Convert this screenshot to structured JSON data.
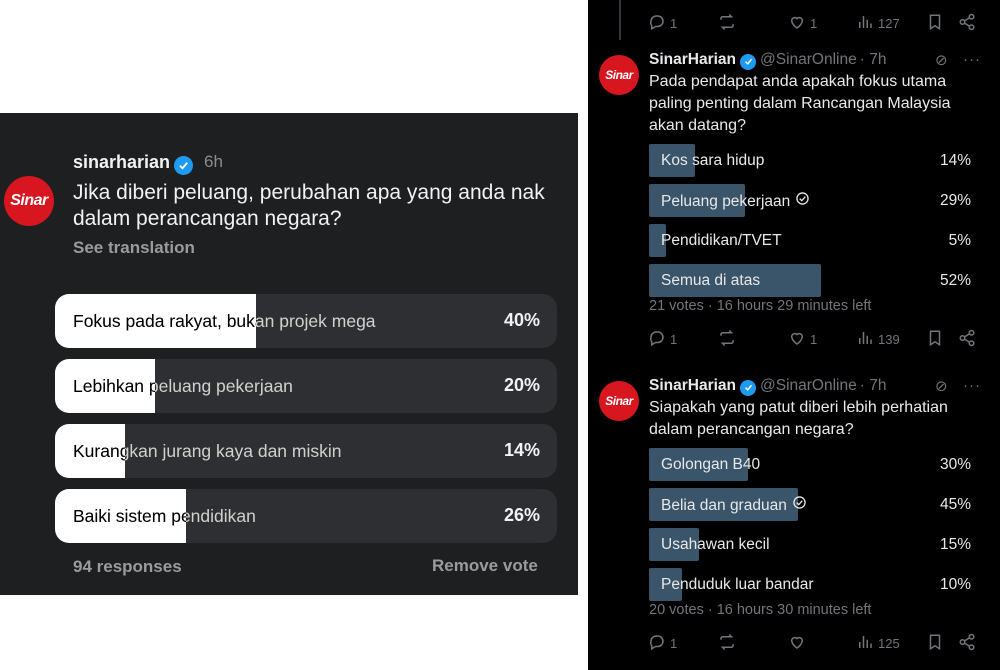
{
  "threads_post": {
    "username": "sinarharian",
    "time": "6h",
    "avatar_text": "Sinar",
    "question": "Jika diberi peluang, perubahan apa yang anda nak dalam perancangan negara?",
    "see_translation": "See translation",
    "options": [
      {
        "label": "Fokus pada rakyat, bukan projek mega",
        "percent_text": "40%",
        "percent": 40
      },
      {
        "label": "Lebihkan peluang pekerjaan",
        "percent_text": "20%",
        "percent": 20
      },
      {
        "label": "Kurangkan jurang kaya dan miskin",
        "percent_text": "14%",
        "percent": 14
      },
      {
        "label": "Baiki sistem pendidikan",
        "percent_text": "26%",
        "percent": 26
      }
    ],
    "responses": "94 responses",
    "remove_vote": "Remove vote"
  },
  "x_feed": {
    "top_actions": {
      "replies": "1",
      "reposts": "",
      "likes": "1",
      "views": "127"
    },
    "tweets": [
      {
        "display_name": "SinarHarian",
        "handle": "@SinarOnline",
        "time": "· 7h",
        "avatar_text": "Sinar",
        "question": "Pada pendapat anda apakah fokus utama paling penting dalam Rancangan Malaysia akan datang?",
        "options": [
          {
            "label": "Kos sara hidup",
            "percent_text": "14%",
            "percent": 14,
            "voted": false
          },
          {
            "label": "Peluang pekerjaan",
            "percent_text": "29%",
            "percent": 29,
            "voted": true
          },
          {
            "label": "Pendidikan/TVET",
            "percent_text": "5%",
            "percent": 5,
            "voted": false
          },
          {
            "label": "Semua di atas",
            "percent_text": "52%",
            "percent": 52,
            "voted": false
          }
        ],
        "meta": "21 votes · 16 hours 29 minutes left",
        "actions": {
          "replies": "1",
          "reposts": "",
          "likes": "1",
          "views": "139"
        }
      },
      {
        "display_name": "SinarHarian",
        "handle": "@SinarOnline",
        "time": "· 7h",
        "avatar_text": "Sinar",
        "question": "Siapakah yang patut diberi lebih perhatian dalam perancangan negara?",
        "options": [
          {
            "label": "Golongan B40",
            "percent_text": "30%",
            "percent": 30,
            "voted": false
          },
          {
            "label": "Belia dan graduan",
            "percent_text": "45%",
            "percent": 45,
            "voted": true
          },
          {
            "label": "Usahawan kecil",
            "percent_text": "15%",
            "percent": 15,
            "voted": false
          },
          {
            "label": "Penduduk luar bandar",
            "percent_text": "10%",
            "percent": 10,
            "voted": false
          }
        ],
        "meta": "20 votes · 16 hours 30 minutes left",
        "actions": {
          "replies": "1",
          "reposts": "",
          "likes": "",
          "views": "125"
        }
      }
    ]
  },
  "colors": {
    "threads_bg": "#1e1f21",
    "x_bg": "#000000",
    "poll_bar": "#3a5469",
    "brand_red": "#d7161f",
    "verified_blue": "#1d9bf0"
  }
}
